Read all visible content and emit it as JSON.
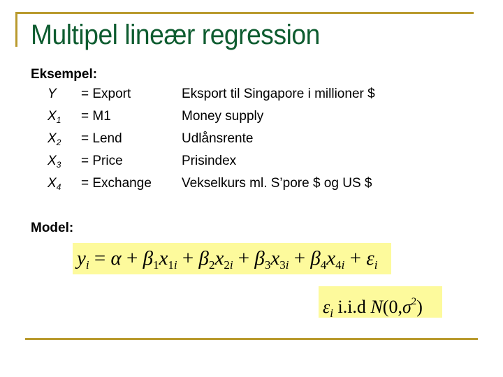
{
  "slide": {
    "title": "Multipel lineær regression",
    "example_heading": "Eksempel:",
    "variables": [
      {
        "symbol": "Y",
        "subscript": "",
        "name": "= Export",
        "description": "Eksport til Singapore i millioner $"
      },
      {
        "symbol": "X",
        "subscript": "1",
        "name": "= M1",
        "description": "Money supply"
      },
      {
        "symbol": "X",
        "subscript": "2",
        "name": "= Lend",
        "description": "Udlånsrente"
      },
      {
        "symbol": "X",
        "subscript": "3",
        "name": "= Price",
        "description": "Prisindex"
      },
      {
        "symbol": "X",
        "subscript": "4",
        "name": "= Exchange",
        "description": "Vekselkurs ml. S’pore $ og US $"
      }
    ],
    "model_heading": "Model:",
    "model_formula": "y_i = α + β_1 x_1i + β_2 x_2i + β_3 x_3i + β_4 x_4i + ε_i",
    "error_formula": "ε_i i.i.d N(0, σ^2)",
    "colors": {
      "title": "#0e5c30",
      "rules": "#b99a2e",
      "formula_highlight": "#fdfa9c"
    }
  }
}
